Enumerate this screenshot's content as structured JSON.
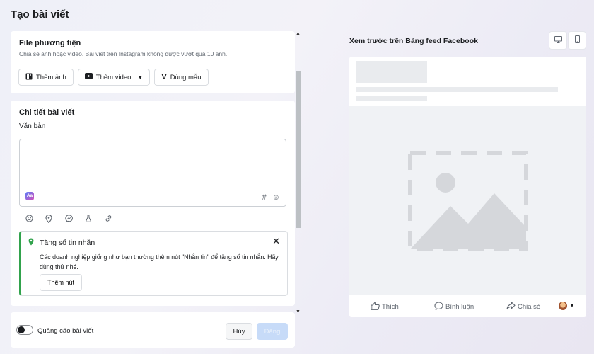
{
  "page": {
    "title": "Tạo bài viết"
  },
  "media": {
    "title": "File phương tiện",
    "subtitle": "Chia sẻ ảnh hoặc video. Bài viết trên Instagram không được vượt quá 10 ảnh.",
    "buttons": {
      "add_photo": "Thêm ảnh",
      "add_video": "Thêm video",
      "use_template": "Dùng mẫu"
    }
  },
  "details": {
    "title": "Chi tiết bài viết",
    "text_label": "Văn bản",
    "text_value": "",
    "hashtag": "#",
    "ai_badge": "Aa"
  },
  "tip": {
    "title": "Tăng số tin nhắn",
    "body": "Các doanh nghiệp giống như bạn thường thêm nút \"Nhắn tin\" để tăng số tin nhắn. Hãy dùng thử nhé.",
    "button": "Thêm nút"
  },
  "footer": {
    "boost_label": "Quảng cáo bài viết",
    "boost_on": false,
    "cancel": "Hủy",
    "post": "Đăng"
  },
  "preview": {
    "title": "Xem trước trên Bảng feed Facebook",
    "actions": {
      "like": "Thích",
      "comment": "Bình luận",
      "share": "Chia sẻ"
    }
  },
  "icons": {
    "add_photo": "photo-plus-icon",
    "add_video": "video-icon",
    "template": "template-v-icon",
    "emoji": "emoji-icon",
    "location": "location-pin-icon",
    "messenger": "messenger-icon",
    "lab": "flask-icon",
    "link": "link-icon",
    "desktop": "desktop-icon",
    "mobile": "mobile-icon"
  },
  "colors": {
    "accent_green": "#31a24c",
    "primary_disabled": "#c7dbf8",
    "scrollbar": "#bcc0c4"
  }
}
